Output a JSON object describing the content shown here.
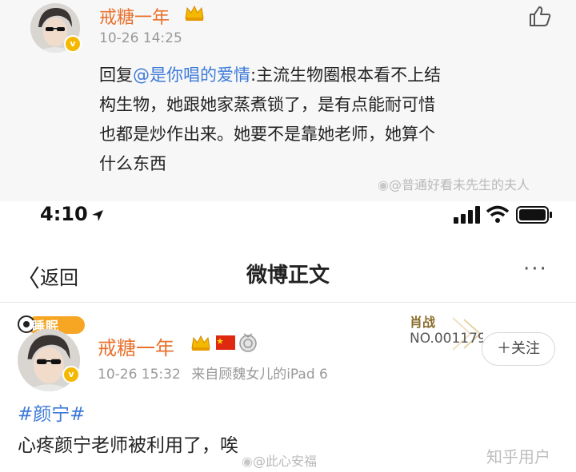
{
  "top_comment": {
    "username": "戒糖一年",
    "timestamp": "10-26 14:25",
    "reply_prefix": "回复",
    "mention": "@是你唱的爱情",
    "body_lines": [
      ":主流生物圈根本看不上结",
      "构生物，她跟她家蒸煮锁了，是有点能耐可惜",
      "也都是炒作出来。她要不是靠她老师，她算个",
      "什么东西"
    ],
    "watermark": "@普通好看未先生的夫人"
  },
  "status_bar": {
    "time": "4:10"
  },
  "nav": {
    "back_label": "返回",
    "title": "微博正文",
    "more": "···"
  },
  "post": {
    "badge_text": "睡眠",
    "username": "戒糖一年",
    "timestamp": "10-26 15:32",
    "source": "来自顾魏女儿的iPad 6",
    "medal_title": "肖战",
    "medal_no": "NO.001179",
    "follow_label": "＋关注",
    "topic": "#颜宁#",
    "text": "心疼颜宁老师被利用了，唉",
    "watermark": "@此心安福"
  },
  "zhihu_watermark": "知乎用户",
  "colors": {
    "username": "#e8712d",
    "link": "#3d7ad8",
    "vip_gold": "#f5b800"
  },
  "icons": [
    "like-icon",
    "verified-badge-icon",
    "vip-crown-icon",
    "weibo-logo-icon",
    "location-arrow-icon",
    "signal-icon",
    "wifi-icon",
    "battery-icon",
    "back-chevron-icon",
    "flag-icon",
    "medal-icon"
  ]
}
